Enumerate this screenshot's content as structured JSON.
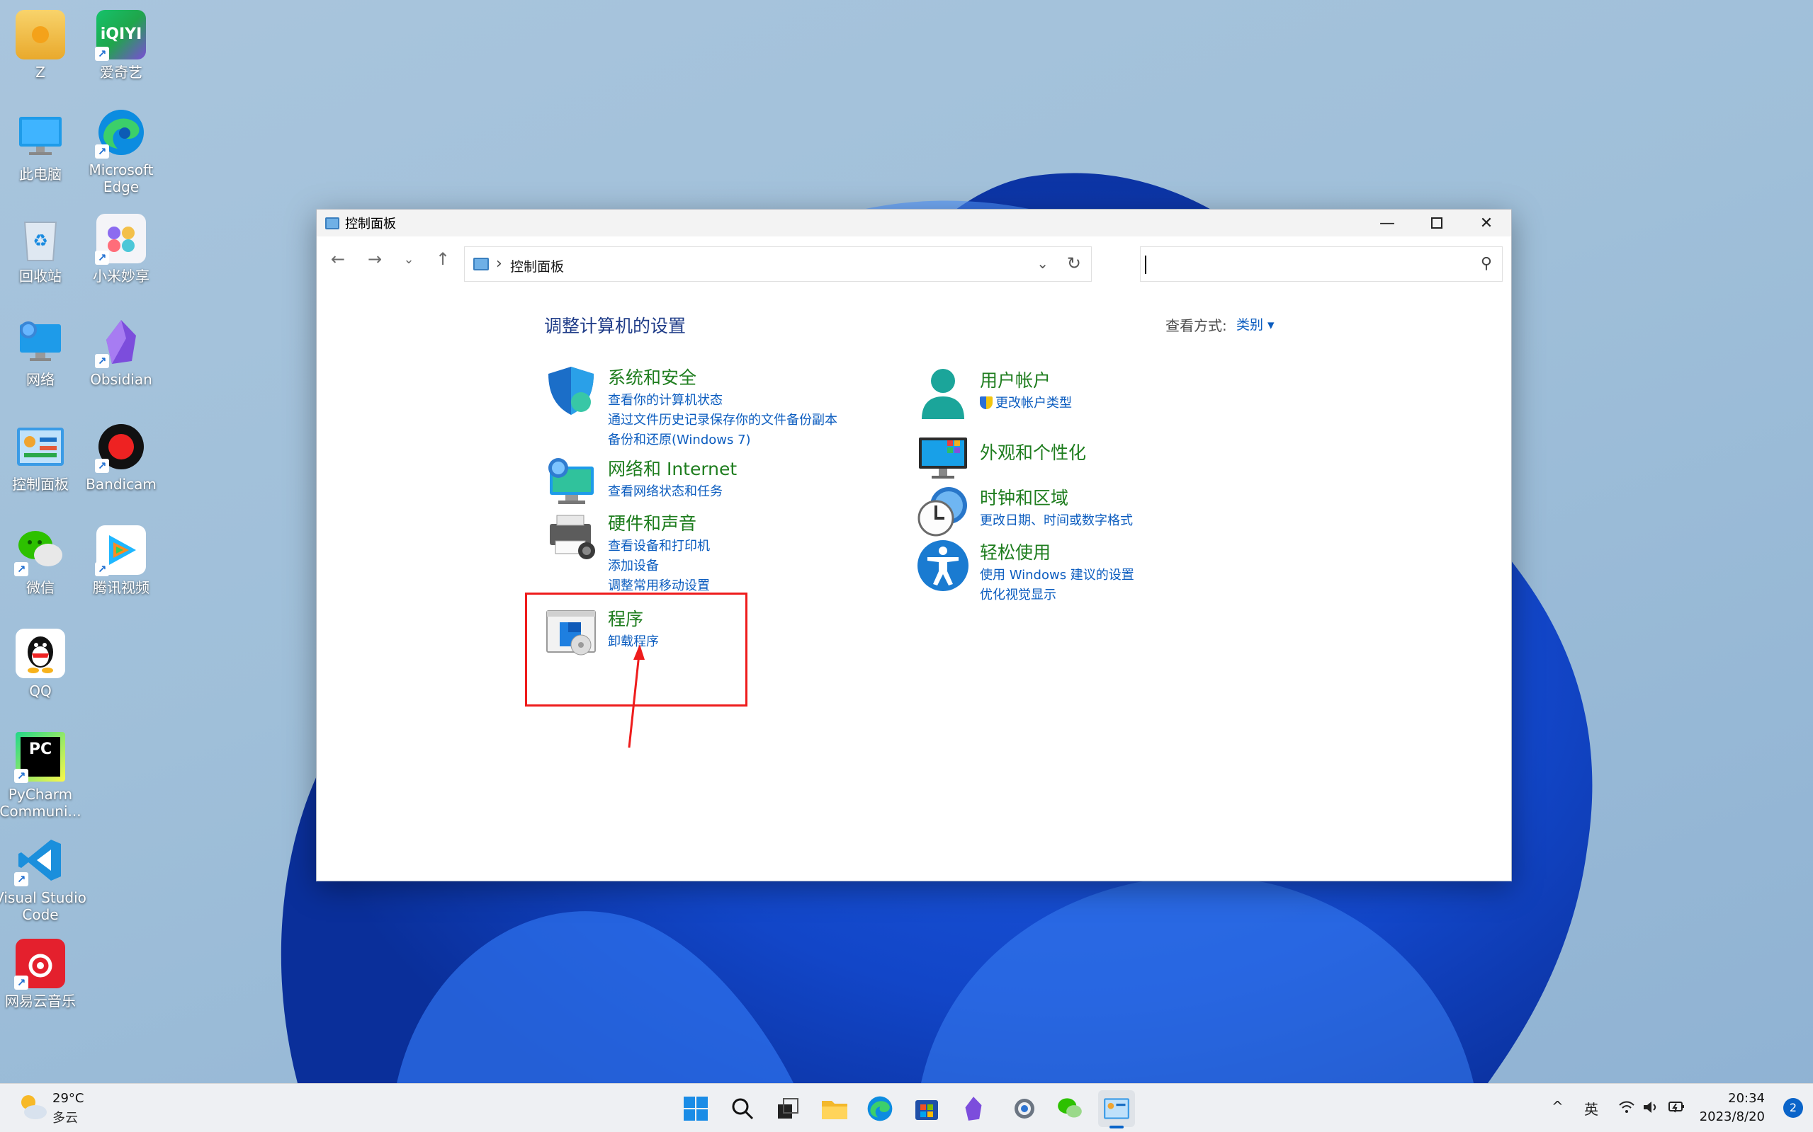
{
  "desktop": {
    "icons": [
      {
        "label": "Z",
        "icon": "user-folder-icon"
      },
      {
        "label": "爱奇艺",
        "icon": "iqiyi-icon"
      },
      {
        "label": "此电脑",
        "icon": "this-pc-icon"
      },
      {
        "label": "Microsoft Edge",
        "icon": "edge-icon"
      },
      {
        "label": "回收站",
        "icon": "recycle-bin-icon"
      },
      {
        "label": "小米妙享",
        "icon": "xiaomi-miaoxiang-icon"
      },
      {
        "label": "网络",
        "icon": "network-icon"
      },
      {
        "label": "Obsidian",
        "icon": "obsidian-icon"
      },
      {
        "label": "控制面板",
        "icon": "control-panel-icon"
      },
      {
        "label": "Bandicam",
        "icon": "bandicam-icon"
      },
      {
        "label": "微信",
        "icon": "wechat-icon"
      },
      {
        "label": "腾讯视频",
        "icon": "tencent-video-icon"
      },
      {
        "label": "QQ",
        "icon": "qq-icon"
      },
      {
        "label": "PyCharm Communi...",
        "icon": "pycharm-icon"
      },
      {
        "label": "Visual Studio Code",
        "icon": "vscode-icon"
      },
      {
        "label": "网易云音乐",
        "icon": "netease-music-icon"
      }
    ]
  },
  "window": {
    "title": "控制面板",
    "address": {
      "path": "控制面板",
      "separator": "›"
    },
    "search": {
      "placeholder": ""
    },
    "heading": "调整计算机的设置",
    "view": {
      "label": "查看方式:",
      "value": "类别 ▾"
    },
    "categories_left": [
      {
        "title": "系统和安全",
        "icon": "shield-icon",
        "links": [
          "查看你的计算机状态",
          "通过文件历史记录保存你的文件备份副本",
          "备份和还原(Windows 7)"
        ]
      },
      {
        "title": "网络和 Internet",
        "icon": "globe-monitor-icon",
        "links": [
          "查看网络状态和任务"
        ]
      },
      {
        "title": "硬件和声音",
        "icon": "printer-icon",
        "links": [
          "查看设备和打印机",
          "添加设备",
          "调整常用移动设置"
        ]
      },
      {
        "title": "程序",
        "icon": "programs-icon",
        "links": [
          "卸载程序"
        ]
      }
    ],
    "categories_right": [
      {
        "title": "用户帐户",
        "icon": "user-icon",
        "links": [
          "更改帐户类型"
        ]
      },
      {
        "title": "外观和个性化",
        "icon": "appearance-monitor-icon",
        "links": []
      },
      {
        "title": "时钟和区域",
        "icon": "clock-globe-icon",
        "links": [
          "更改日期、时间或数字格式"
        ]
      },
      {
        "title": "轻松使用",
        "icon": "accessibility-icon",
        "links": [
          "使用 Windows 建议的设置",
          "优化视觉显示"
        ]
      }
    ],
    "highlight_color": "#ee1c1c"
  },
  "taskbar": {
    "weather": {
      "temp": "29°C",
      "condition": "多云"
    },
    "apps": [
      "start-icon",
      "search-icon",
      "task-view-icon",
      "file-explorer-icon",
      "edge-icon",
      "store-icon",
      "obsidian-icon",
      "settings-icon",
      "wechat-icon",
      "control-panel-icon"
    ],
    "tray": {
      "chevron": "^",
      "ime": "英"
    },
    "clock": {
      "time": "20:34",
      "date": "2023/8/20"
    },
    "notifications": "2"
  },
  "colors": {
    "accent": "#0a64c9",
    "category_title": "#1e7d1e",
    "link": "#0b5cbf",
    "heading": "#1f3c88"
  }
}
